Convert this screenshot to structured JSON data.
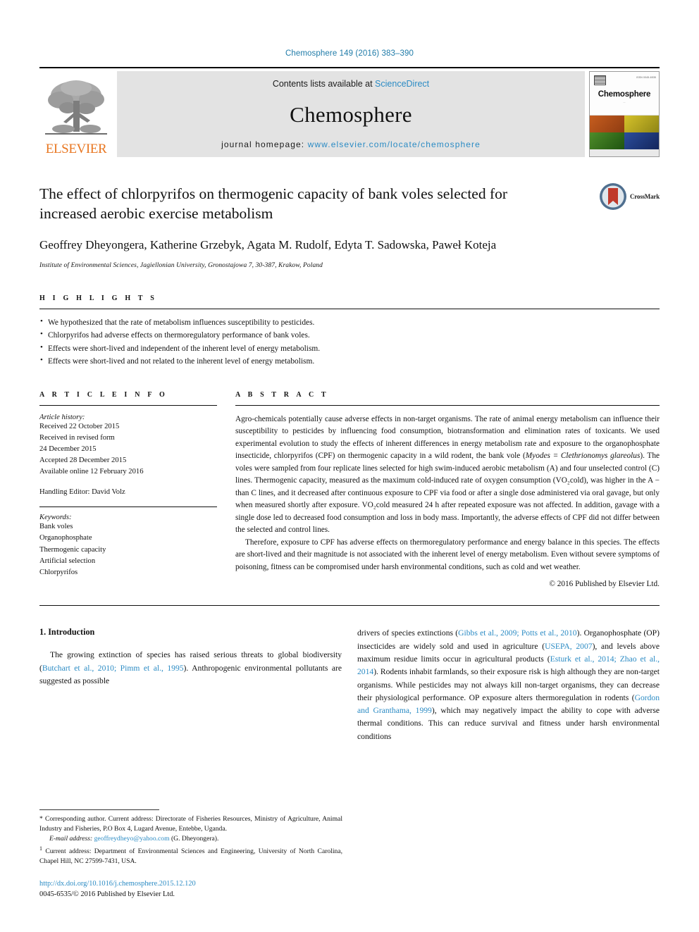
{
  "running_head": "Chemosphere 149 (2016) 383–390",
  "masthead": {
    "publisher_name": "ELSEVIER",
    "contents_prefix": "Contents lists available at ",
    "sciencedirect": "ScienceDirect",
    "journal_title": "Chemosphere",
    "homepage_prefix": "journal homepage: ",
    "homepage_url": "www.elsevier.com/locate/chemosphere",
    "cover": {
      "name": "Chemosphere",
      "subtitle": "...",
      "issn": "ISSN 0045-6535"
    }
  },
  "article": {
    "title": "The effect of chlorpyrifos on thermogenic capacity of bank voles selected for increased aerobic exercise metabolism",
    "authors": "Geoffrey Dheyongera, Katherine Grzebyk, Agata M. Rudolf, Edyta T. Sadowska, Paweł Koteja",
    "affiliation": "Institute of Environmental Sciences, Jagiellonian University, Gronostajowa 7, 30-387, Krakow, Poland",
    "crossmark_label": "CrossMark"
  },
  "highlights": {
    "heading": "H I G H L I G H T S",
    "items": [
      "We hypothesized that the rate of metabolism influences susceptibility to pesticides.",
      "Chlorpyrifos had adverse effects on thermoregulatory performance of bank voles.",
      "Effects were short-lived and independent of the inherent level of energy metabolism.",
      "Effects were short-lived and not related to the inherent level of energy metabolism."
    ]
  },
  "article_info": {
    "heading": "A R T I C L E   I N F O",
    "history_label": "Article history:",
    "history": [
      "Received 22 October 2015",
      "Received in revised form",
      "24 December 2015",
      "Accepted 28 December 2015",
      "Available online 12 February 2016"
    ],
    "handling_editor": "Handling Editor: David Volz",
    "keywords_label": "Keywords:",
    "keywords": [
      "Bank voles",
      "Organophosphate",
      "Thermogenic capacity",
      "Artificial selection",
      "Chlorpyrifos"
    ]
  },
  "abstract": {
    "heading": "A B S T R A C T",
    "paragraph1_a": "Agro-chemicals potentially cause adverse effects in non-target organisms. The rate of animal energy metabolism can influence their susceptibility to pesticides by influencing food consumption, biotransformation and elimination rates of toxicants. We used experimental evolution to study the effects of inherent differences in energy metabolism rate and exposure to the organophosphate insecticide, chlorpyrifos (CPF) on thermogenic capacity in a wild rodent, the bank vole (",
    "species_italic": "Myodes = Clethrionomys glareolus",
    "paragraph1_b": "). The voles were sampled from four replicate lines selected for high swim-induced aerobic metabolism (A) and four unselected control (C) lines. Thermogenic capacity, measured as the maximum cold-induced rate of oxygen consumption (VO₂cold), was higher in the A − than C lines, and it decreased after continuous exposure to CPF via food or after a single dose administered via oral gavage, but only when measured shortly after exposure. VO₂cold measured 24 h after repeated exposure was not affected. In addition, gavage with a single dose led to decreased food consumption and loss in body mass. Importantly, the adverse effects of CPF did not differ between the selected and control lines.",
    "paragraph2": "Therefore, exposure to CPF has adverse effects on thermoregulatory performance and energy balance in this species. The effects are short-lived and their magnitude is not associated with the inherent level of energy metabolism. Even without severe symptoms of poisoning, fitness can be compromised under harsh environmental conditions, such as cold and wet weather.",
    "copyright": "© 2016 Published by Elsevier Ltd."
  },
  "introduction": {
    "heading": "1. Introduction",
    "left_para_a": "The growing extinction of species has raised serious threats to global biodiversity (",
    "left_cit_1": "Butchart et al., 2010; Pimm et al., 1995",
    "left_para_b": "). Anthropogenic environmental pollutants are suggested as possible",
    "right_para_a": "drivers of species extinctions (",
    "right_cit_1": "Gibbs et al., 2009; Potts et al., 2010",
    "right_para_b": "). Organophosphate (OP) insecticides are widely sold and used in agriculture (",
    "right_cit_2": "USEPA, 2007",
    "right_para_c": "), and levels above maximum residue limits occur in agricultural products (",
    "right_cit_3": "Esturk et al., 2014; Zhao et al., 2014",
    "right_para_d": "). Rodents inhabit farmlands, so their exposure risk is high although they are non-target organisms. While pesticides may not always kill non-target organisms, they can decrease their physiological performance. OP exposure alters thermoregulation in rodents (",
    "right_cit_4": "Gordon and Granthama, 1999",
    "right_para_e": "), which may negatively impact the ability to cope with adverse thermal conditions. This can reduce survival and fitness under harsh environmental conditions"
  },
  "footnotes": {
    "corresponding_marker": "*",
    "corresponding": "Corresponding author. Current address: Directorate of Fisheries Resources, Ministry of Agriculture, Animal Industry and Fisheries, P.O Box 4, Lugard Avenue, Entebbe, Uganda.",
    "email_label": "E-mail address:",
    "email": "geoffreydheyo@yahoo.com",
    "email_owner": "(G. Dheyongera).",
    "current_address_marker": "1",
    "current_address": "Current address: Department of Environmental Sciences and Engineering, University of North Carolina, Chapel Hill, NC 27599-7431, USA.",
    "doi": "http://dx.doi.org/10.1016/j.chemosphere.2015.12.120",
    "issn_line": "0045-6535/© 2016 Published by Elsevier Ltd."
  },
  "colors": {
    "link_blue": "#2b8bc4",
    "elsevier_orange": "#E87722",
    "band_gray": "#e3e3e3"
  }
}
